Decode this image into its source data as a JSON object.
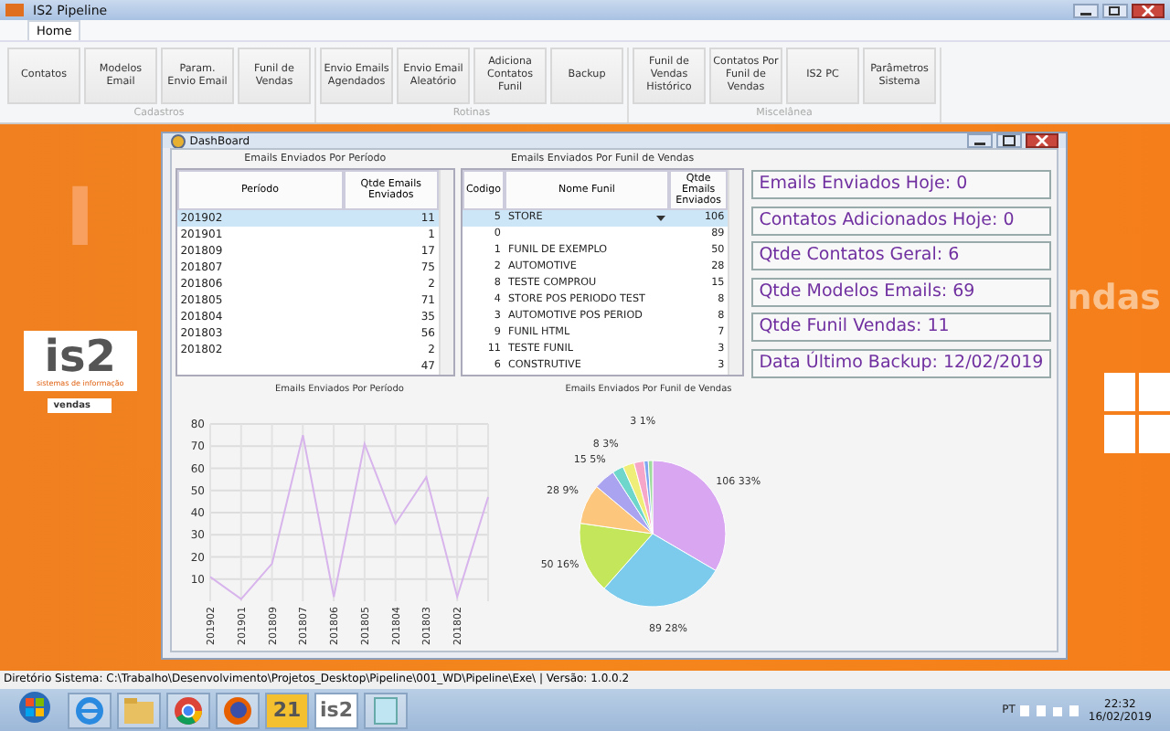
{
  "window": {
    "title": "IS2 Pipeline"
  },
  "tabs": [
    {
      "label": "Home",
      "selected": true
    }
  ],
  "ribbon_groups": [
    {
      "label": "Cadastros",
      "buttons": [
        "Contatos",
        "Modelos Email",
        "Param. Envio Email",
        "Funil de Vendas"
      ]
    },
    {
      "label": "Rotinas",
      "buttons": [
        "Envio Emails Agendados",
        "Envio Email Aleatório",
        "Adiciona Contatos Funil",
        "Backup"
      ]
    },
    {
      "label": "Miscelânea",
      "buttons": [
        "Funil de Vendas Histórico",
        "Contatos Por Funil de Vendas",
        "IS2 PC",
        "Parâmetros Sistema"
      ]
    }
  ],
  "background": {
    "banner_left": "I",
    "banner_right": "ndas",
    "logo": "is2",
    "logo_caption": "sistemas de informação",
    "badge": "vendas"
  },
  "dashboard": {
    "title": "DashBoard",
    "period_table": {
      "title": "Emails Enviados Por Período",
      "columns": [
        "Período",
        "Qtde Emails Enviados"
      ],
      "rows": [
        {
          "cells": [
            "201902",
            "11"
          ],
          "selected": true
        },
        {
          "cells": [
            "201901",
            "1"
          ],
          "selected": false
        },
        {
          "cells": [
            "201809",
            "17"
          ],
          "selected": false
        },
        {
          "cells": [
            "201807",
            "75"
          ],
          "selected": false
        },
        {
          "cells": [
            "201806",
            "2"
          ],
          "selected": false
        },
        {
          "cells": [
            "201805",
            "71"
          ],
          "selected": false
        },
        {
          "cells": [
            "201804",
            "35"
          ],
          "selected": false
        },
        {
          "cells": [
            "201803",
            "56"
          ],
          "selected": false
        },
        {
          "cells": [
            "201802",
            "2"
          ],
          "selected": false
        },
        {
          "cells": [
            "",
            "47"
          ],
          "selected": false
        }
      ]
    },
    "funnel_table": {
      "title": "Emails Enviados Por Funil de Vendas",
      "columns": [
        "Codigo",
        "Nome Funil",
        "Qtde Emails Enviados"
      ],
      "rows": [
        {
          "cells": [
            "5",
            "STORE",
            "106"
          ],
          "selected": true
        },
        {
          "cells": [
            "0",
            "",
            "89"
          ],
          "selected": false
        },
        {
          "cells": [
            "1",
            "FUNIL DE EXEMPLO",
            "50"
          ],
          "selected": false
        },
        {
          "cells": [
            "2",
            "AUTOMOTIVE",
            "28"
          ],
          "selected": false
        },
        {
          "cells": [
            "8",
            "TESTE COMPROU",
            "15"
          ],
          "selected": false
        },
        {
          "cells": [
            "4",
            "STORE POS PERIODO TEST",
            "8"
          ],
          "selected": false
        },
        {
          "cells": [
            "3",
            "AUTOMOTIVE POS PERIOD",
            "8"
          ],
          "selected": false
        },
        {
          "cells": [
            "9",
            "FUNIL HTML",
            "7"
          ],
          "selected": false
        },
        {
          "cells": [
            "11",
            "TESTE FUNIL",
            "3"
          ],
          "selected": false
        },
        {
          "cells": [
            "6",
            "CONSTRUTIVE",
            "3"
          ],
          "selected": false
        }
      ]
    },
    "stats": [
      "Emails Enviados Hoje: 0",
      "Contatos Adicionados Hoje: 0",
      "Qtde Contatos Geral: 6",
      "Qtde Modelos Emails: 69",
      "Qtde Funil Vendas: 11",
      "Data Último Backup: 12/02/2019"
    ],
    "line_chart": {
      "chart_data": {
        "type": "line",
        "title": "Emails Enviados Por Período",
        "categories": [
          "201902",
          "201901",
          "201809",
          "201807",
          "201806",
          "201805",
          "201804",
          "201803",
          "201802",
          null
        ],
        "series": [
          {
            "color": "#d8b4ec",
            "values": [
              11,
              1,
              17,
              75,
              2,
              71,
              35,
              56,
              2,
              47
            ]
          }
        ],
        "grid": true,
        "ylim": [
          0,
          80
        ],
        "yticks": [
          10,
          20,
          30,
          40,
          50,
          60,
          70,
          80
        ]
      }
    },
    "pie_chart": {
      "chart_data": {
        "type": "pie",
        "title": "Emails Enviados Por Funil de Vendas",
        "values": [
          106,
          89,
          50,
          28,
          15,
          8,
          8,
          7,
          3,
          3
        ],
        "colors": [
          "#d9a6f2",
          "#7ccbec",
          "#c4e65a",
          "#fcc67c",
          "#a9a3f0",
          "#6fd6cc",
          "#eeee78",
          "#f6a6c8",
          "#7fa6f0",
          "#9edc9e"
        ],
        "value_labels": [
          "106 33%",
          "89 28%",
          "50 16%",
          "28 9%",
          "15 5%",
          "8 3%",
          null,
          null,
          "3 1%",
          null
        ]
      }
    }
  },
  "status_bar": "Diretório Sistema: C:\\Trabalho\\Desenvolvimento\\Projetos_Desktop\\Pipeline\\001_WD\\Pipeline\\Exe\\ | Versão: 1.0.0.2",
  "taskbar": {
    "apps": [
      {
        "kind": "ie"
      },
      {
        "kind": "folder"
      },
      {
        "kind": "chrome"
      },
      {
        "kind": "firefox"
      },
      {
        "kind": "tile",
        "label": "21"
      },
      {
        "kind": "tile",
        "label": "is2"
      },
      {
        "kind": "notepad"
      }
    ],
    "language": "PT",
    "time": "22:32",
    "date": "16/02/2019"
  }
}
